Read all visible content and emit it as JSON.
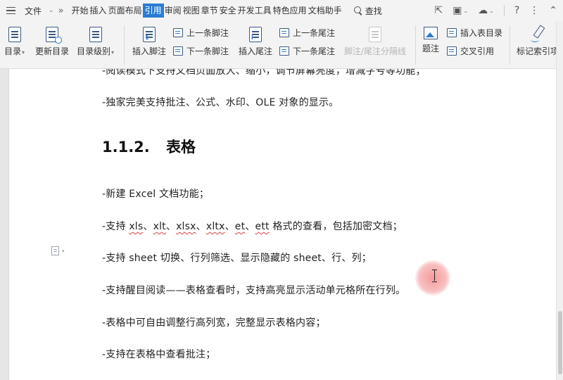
{
  "menubar": {
    "file_label": "文件",
    "tabs": [
      "开始",
      "插入",
      "页面布局",
      "引用",
      "审阅",
      "视图",
      "章节",
      "安全",
      "开发工具",
      "特色应用",
      "文档助手"
    ],
    "active_tab": "引用",
    "search_label": "查找"
  },
  "ribbon": {
    "toc": "目录",
    "update_toc": "更新目录",
    "toc_level": "目录级别",
    "insert_footnote": "插入脚注",
    "prev_footnote": "上一条脚注",
    "next_footnote": "下一条脚注",
    "insert_endnote": "插入尾注",
    "prev_endnote": "上一条尾注",
    "next_endnote": "下一条尾注",
    "footnote_separator": "脚注/尾注分隔线",
    "caption": "题注",
    "insert_table_of_figures": "插入表目录",
    "cross_reference": "交叉引用",
    "mark_index": "标记索引项"
  },
  "document": {
    "para_top": "-阅读模式下支持文档页面放大、缩小，调节屏幕亮度，增减字号等功能；",
    "para_1": "-独家完美支持批注、公式、水印、OLE 对象的显示。",
    "heading_number": "1.1.2.",
    "heading_text": "表格",
    "para_2": "-新建 Excel 文档功能；",
    "para_3": {
      "a": "-支持 ",
      "e1": "xls",
      "b": "、",
      "e2": "xlt",
      "c": "、",
      "e3": "xlsx",
      "d": "、",
      "e4": "xltx",
      "e": "、",
      "e5": "et",
      "f": "、",
      "e6": "ett",
      "g": " 格式的查看，包括加密文档；"
    },
    "para_4": "-支持 sheet 切换、行列筛选、显示隐藏的 sheet、行、列；",
    "para_5": "-支持醒目阅读——表格查看时，支持高亮显示活动单元格所在行列。",
    "para_6": "-表格中可自由调整行高列宽，完整显示表格内容；",
    "para_7": "-支持在表格中查看批注；"
  }
}
